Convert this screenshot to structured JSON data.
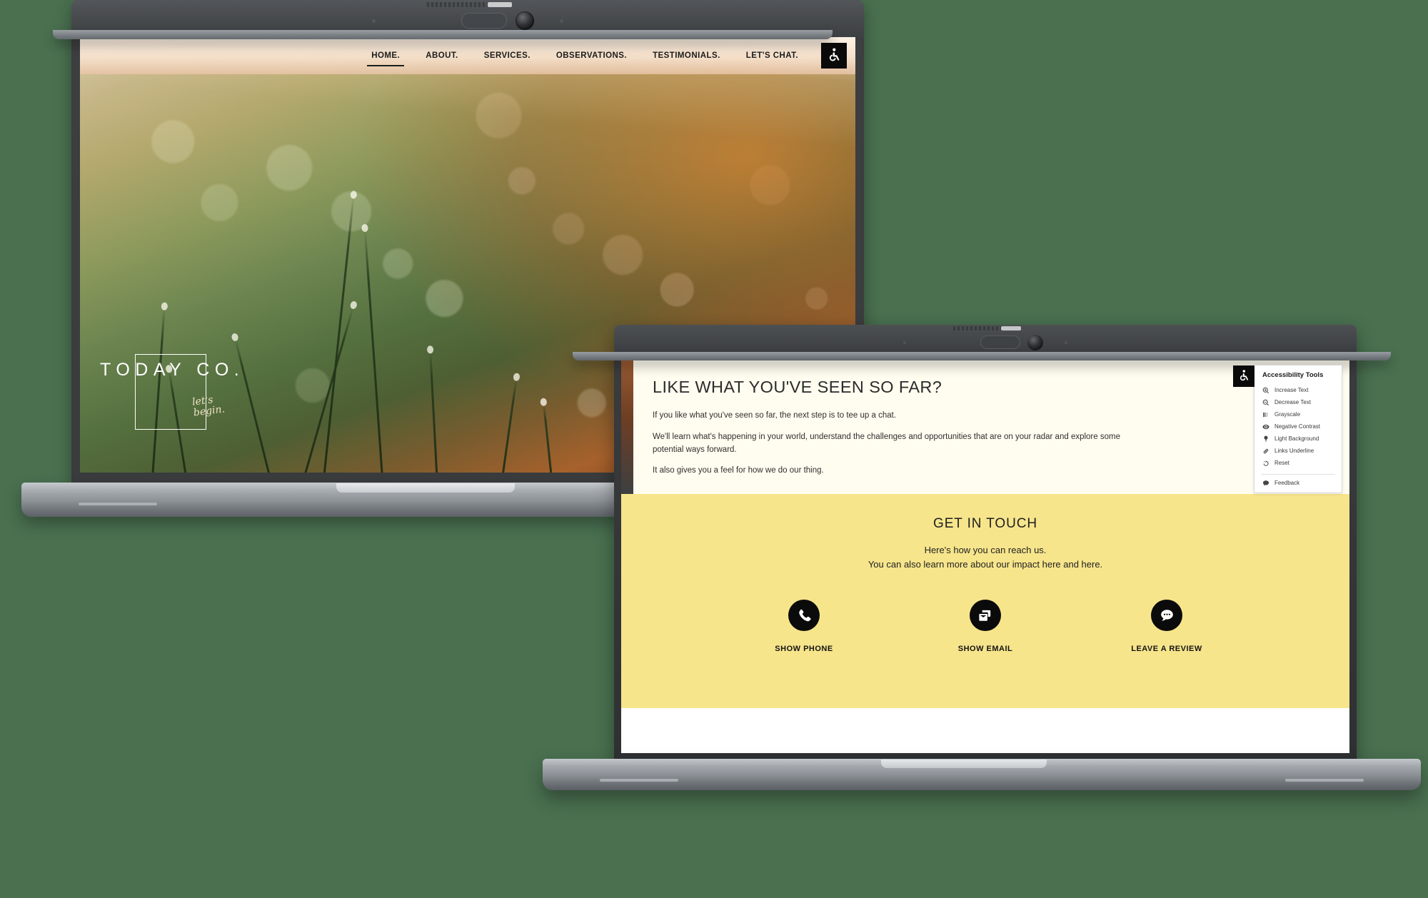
{
  "background_color": "#4a7050",
  "laptop_one": {
    "site_nav": {
      "items": [
        {
          "label": "HOME.",
          "active": true
        },
        {
          "label": "ABOUT.",
          "active": false
        },
        {
          "label": "SERVICES.",
          "active": false
        },
        {
          "label": "OBSERVATIONS.",
          "active": false
        },
        {
          "label": "TESTIMONIALS.",
          "active": false
        },
        {
          "label": "LET'S CHAT.",
          "active": false
        }
      ],
      "accessibility_icon": "wheelchair-accessibility-icon"
    },
    "hero": {
      "logo_text": "TODAY CO.",
      "logo_line1": "let's",
      "logo_line2": "begin.",
      "image_description": "dew-covered-grass-bokeh-sunset"
    }
  },
  "laptop_two": {
    "cream_section": {
      "heading": "LIKE WHAT YOU'VE SEEN SO FAR?",
      "paragraphs": [
        "If you like what you've seen so far, the next step is to tee up a chat.",
        "We'll learn what's happening in your world, understand the challenges and opportunities that are on your radar and explore some potential ways forward.",
        "It also gives you a feel for how we do our thing."
      ]
    },
    "accessibility_panel": {
      "tab_icon": "wheelchair-accessibility-icon",
      "title": "Accessibility Tools",
      "items": [
        {
          "label": "Increase Text",
          "icon": "magnifier-plus-icon"
        },
        {
          "label": "Decrease Text",
          "icon": "magnifier-minus-icon"
        },
        {
          "label": "Grayscale",
          "icon": "grayscale-bars-icon"
        },
        {
          "label": "Negative Contrast",
          "icon": "eye-icon"
        },
        {
          "label": "Light Background",
          "icon": "lightbulb-icon"
        },
        {
          "label": "Links Underline",
          "icon": "link-icon"
        },
        {
          "label": "Reset",
          "icon": "undo-arrow-icon"
        }
      ],
      "footer_item": {
        "label": "Feedback",
        "icon": "speech-bubble-icon"
      }
    },
    "get_in_touch": {
      "background_color": "#f7e58c",
      "title": "GET IN TOUCH",
      "subtitle_line1": "Here's how you can reach us.",
      "subtitle_line2": "You can also learn more about our impact here and here.",
      "actions": [
        {
          "label": "SHOW PHONE",
          "icon": "phone-icon"
        },
        {
          "label": "SHOW EMAIL",
          "icon": "email-stack-icon"
        },
        {
          "label": "LEAVE A REVIEW",
          "icon": "chat-bubble-dots-icon"
        }
      ]
    }
  }
}
